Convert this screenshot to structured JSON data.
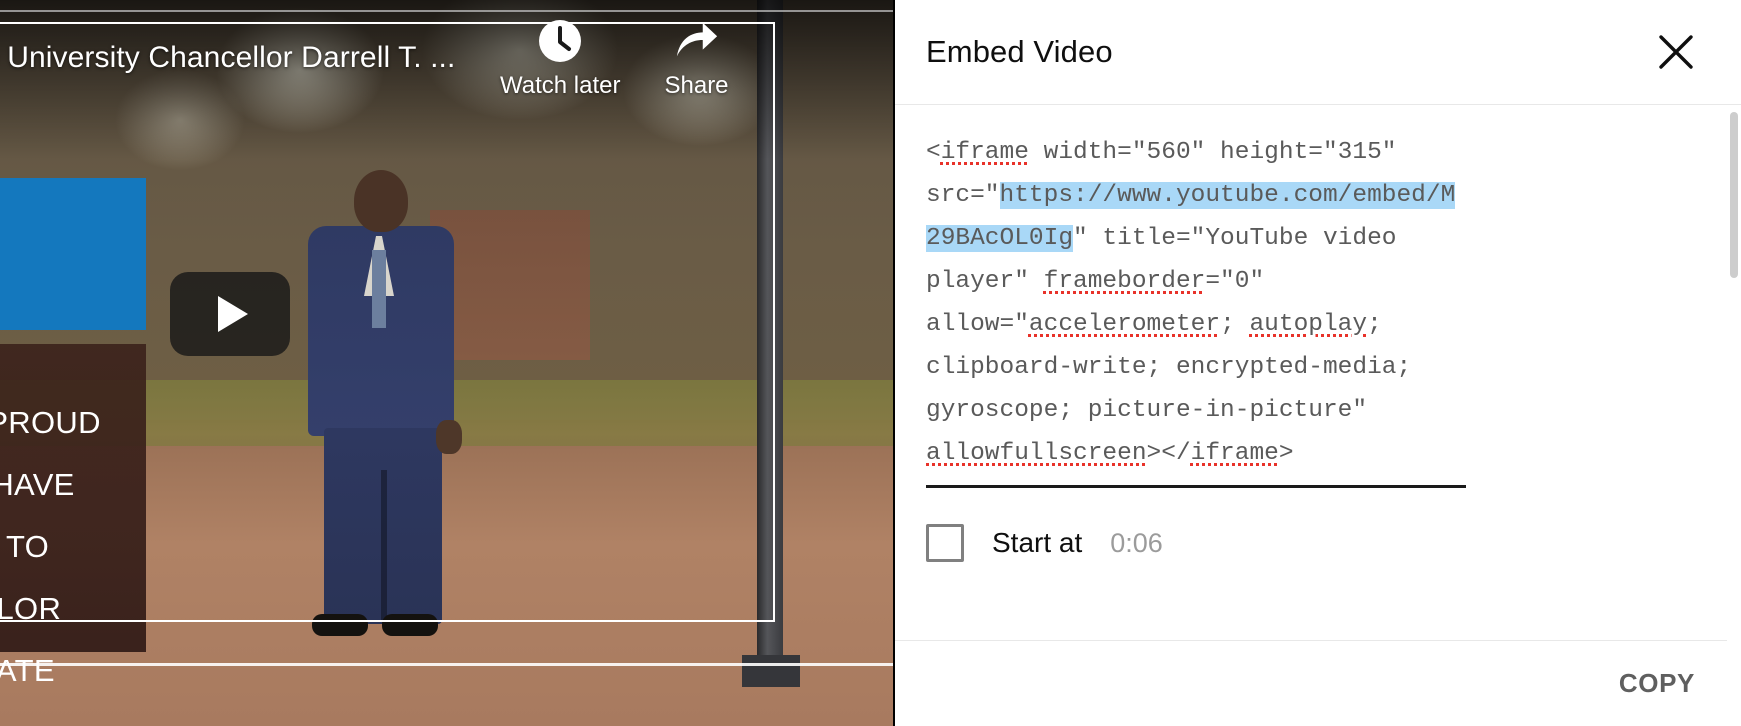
{
  "player": {
    "title": "e University Chancellor Darrell T. ...",
    "actions": [
      {
        "label": "Watch later",
        "icon": "clock-icon"
      },
      {
        "label": "Share",
        "icon": "share-arrow-icon"
      }
    ],
    "play_icon": "play-icon",
    "quote_lines": [
      "Y PROUD",
      "O HAVE",
      "TY TO",
      "ELLOR",
      " STATE"
    ]
  },
  "embed": {
    "title": "Embed Video",
    "close_icon": "close-icon",
    "code": {
      "before_url": "<iframe width=\"560\" height=\"315\" src=\"",
      "highlighted_url": "https://www.youtube.com/embed/M29BAcOL0Ig",
      "after_url": "\" title=\"YouTube video player\" frameborder=\"0\" allow=\"accelerometer; autoplay; clipboard-write; encrypted-media; gyroscope; picture-in-picture\" allowfullscreen></iframe>",
      "segments": [
        {
          "text": "<",
          "style": "plain"
        },
        {
          "text": "iframe",
          "style": "spell"
        },
        {
          "text": " width=\"560\" height=\"315\" src=\"",
          "style": "plain"
        },
        {
          "text": "https://www.youtube.com/embed/M29BAcOL0Ig",
          "style": "highlight"
        },
        {
          "text": "\" title=\"YouTube video player\" ",
          "style": "plain"
        },
        {
          "text": "frameborder",
          "style": "spell"
        },
        {
          "text": "=\"0\" allow=\"",
          "style": "plain"
        },
        {
          "text": "accelerometer",
          "style": "spell"
        },
        {
          "text": "; ",
          "style": "plain"
        },
        {
          "text": "autoplay",
          "style": "spell"
        },
        {
          "text": "; clipboard-write; encrypted-media; gyroscope; picture-in-picture\" ",
          "style": "plain"
        },
        {
          "text": "allowfullscreen",
          "style": "spell"
        },
        {
          "text": "></",
          "style": "plain"
        },
        {
          "text": "iframe",
          "style": "spell"
        },
        {
          "text": ">",
          "style": "plain"
        }
      ]
    },
    "start_at": {
      "label": "Start at",
      "time": "0:06",
      "checked": false
    },
    "copy_label": "COPY"
  },
  "colors": {
    "highlight": "#a9d8f7",
    "spellcheck": "#e8322a",
    "code_text": "#5a5a5a",
    "brand_blue": "#1478be"
  }
}
